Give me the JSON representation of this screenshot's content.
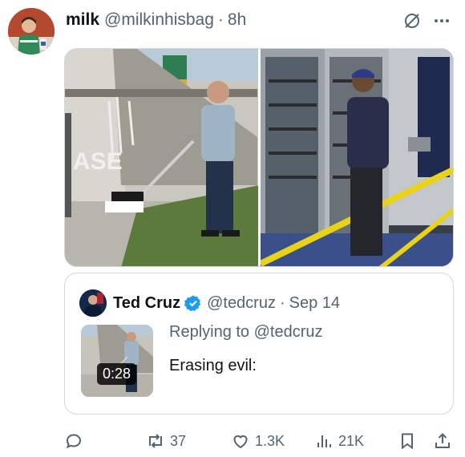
{
  "tweet": {
    "display_name": "milk",
    "handle": "@milkinhisbag",
    "separator": "·",
    "time": "8h"
  },
  "header_icons": [
    "grok-icon",
    "more-icon"
  ],
  "media": {
    "images": [
      "man-mopping-graffiti-photo",
      "worker-at-electrical-panel-photo"
    ]
  },
  "quote": {
    "display_name": "Ted Cruz",
    "verified": true,
    "handle": "@tedcruz",
    "separator": "·",
    "date": "Sep 14",
    "video_duration": "0:28",
    "replying_to": "Replying to @tedcruz",
    "text": "Erasing evil:"
  },
  "actions": {
    "reply": {
      "icon": "reply-icon",
      "count": ""
    },
    "retweet": {
      "icon": "retweet-icon",
      "count": "37"
    },
    "like": {
      "icon": "like-icon",
      "count": "1.3K"
    },
    "views": {
      "icon": "views-icon",
      "count": "21K"
    },
    "bookmark": {
      "icon": "bookmark-icon",
      "count": ""
    },
    "share": {
      "icon": "share-icon",
      "count": ""
    }
  },
  "colors": {
    "text": "#0f1419",
    "secondary": "#536471",
    "border": "#cfd9de",
    "verified": "#1d9bf0"
  }
}
